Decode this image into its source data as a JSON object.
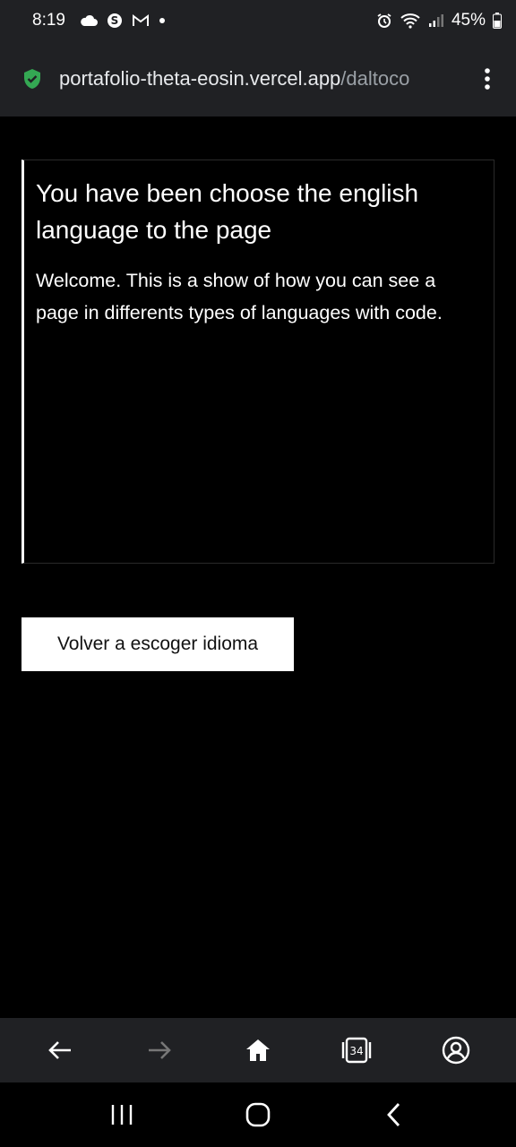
{
  "status_bar": {
    "time": "8:19",
    "battery": "45%"
  },
  "browser": {
    "url_domain": "portafolio-theta-eosin.vercel.app",
    "url_path": "/daltoco",
    "tabs_count": "34"
  },
  "content": {
    "title": "You have been choose the english language to the page",
    "body": "Welcome. This is a show of how you can see a page in differents types of languages with code.",
    "back_button_label": "Volver a escoger idioma"
  },
  "colors": {
    "background": "#000000",
    "bar": "#202124",
    "secure": "#34a853"
  }
}
